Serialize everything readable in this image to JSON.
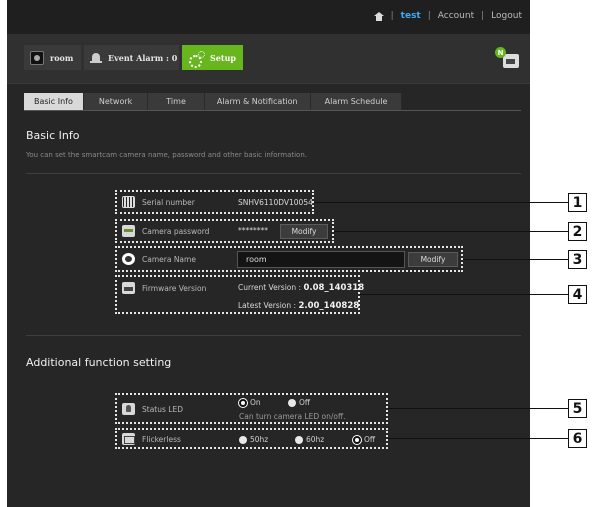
{
  "topnav": {
    "user": "test",
    "account": "Account",
    "logout": "Logout",
    "sep": "|"
  },
  "header": {
    "tabs": [
      {
        "label": "room",
        "icon": "camera-icon"
      },
      {
        "label": "Event Alarm : 0",
        "icon": "bell-icon"
      },
      {
        "label": "Setup",
        "icon": "gear-icon",
        "active": true
      }
    ],
    "profile_badge": "N"
  },
  "subtabs": [
    "Basic Info",
    "Network",
    "Time",
    "Alarm & Notification",
    "Alarm Schedule"
  ],
  "basic_info": {
    "title": "Basic Info",
    "description": "You can set the smartcam camera name, password and other basic information.",
    "serial": {
      "label": "Serial number",
      "value": "SNHV6110DV10054"
    },
    "password": {
      "label": "Camera password",
      "value": "********",
      "button": "Modify"
    },
    "camera_name": {
      "label": "Camera Name",
      "value": "room",
      "button": "Modify"
    },
    "firmware": {
      "label": "Firmware Version",
      "current_label": "Current Version :",
      "current_value": "0.08_140318",
      "latest_label": "Latest Version :",
      "latest_value": "2.00_140828"
    }
  },
  "additional": {
    "title": "Additional function setting",
    "status_led": {
      "label": "Status LED",
      "on": "On",
      "off": "Off",
      "hint": "Can turn camera LED on/off.",
      "selected": "On"
    },
    "flickerless": {
      "label": "Flickerless",
      "options": [
        "50hz",
        "60hz",
        "Off"
      ],
      "selected": "Off"
    }
  },
  "callouts": [
    "1",
    "2",
    "3",
    "4",
    "5",
    "6"
  ]
}
